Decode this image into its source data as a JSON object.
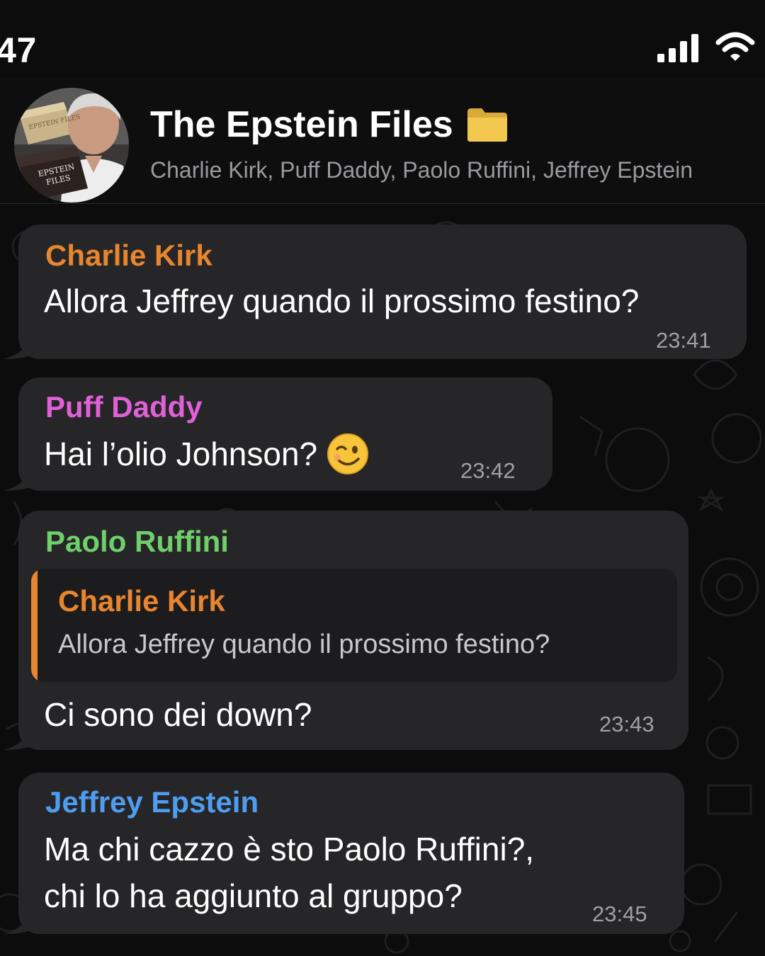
{
  "status_bar": {
    "time": ":47",
    "icons": [
      "signal-icon",
      "wifi-icon"
    ]
  },
  "header": {
    "title": "The Epstein Files",
    "title_icon": "folder-icon",
    "members": "Charlie Kirk, Puff Daddy, Paolo Ruffini, Jeffrey Epstein",
    "avatar": {
      "box_top": "EPSTEIN FILES",
      "box_bottom": "EPSTEIN FILES"
    }
  },
  "messages": [
    {
      "sender": "Charlie Kirk",
      "sender_color": "#e8852e",
      "text": "Allora Jeffrey quando il prossimo festino?",
      "time": "23:41"
    },
    {
      "sender": "Puff Daddy",
      "sender_color": "#e060d8",
      "text": "Hai l’olio Johnson?",
      "emoji": "winking-face-emoji",
      "time": "23:42"
    },
    {
      "sender": "Paolo Ruffini",
      "sender_color": "#6fcf6a",
      "reply": {
        "sender": "Charlie Kirk",
        "text": "Allora Jeffrey quando il prossimo festino?"
      },
      "text": "Ci sono dei down?",
      "time": "23:43"
    },
    {
      "sender": "Jeffrey Epstein",
      "sender_color": "#4f9df0",
      "text_line1": "Ma chi cazzo è sto Paolo Ruffini?,",
      "text_line2": "chi lo ha aggiunto al gruppo?",
      "time": "23:45"
    }
  ]
}
